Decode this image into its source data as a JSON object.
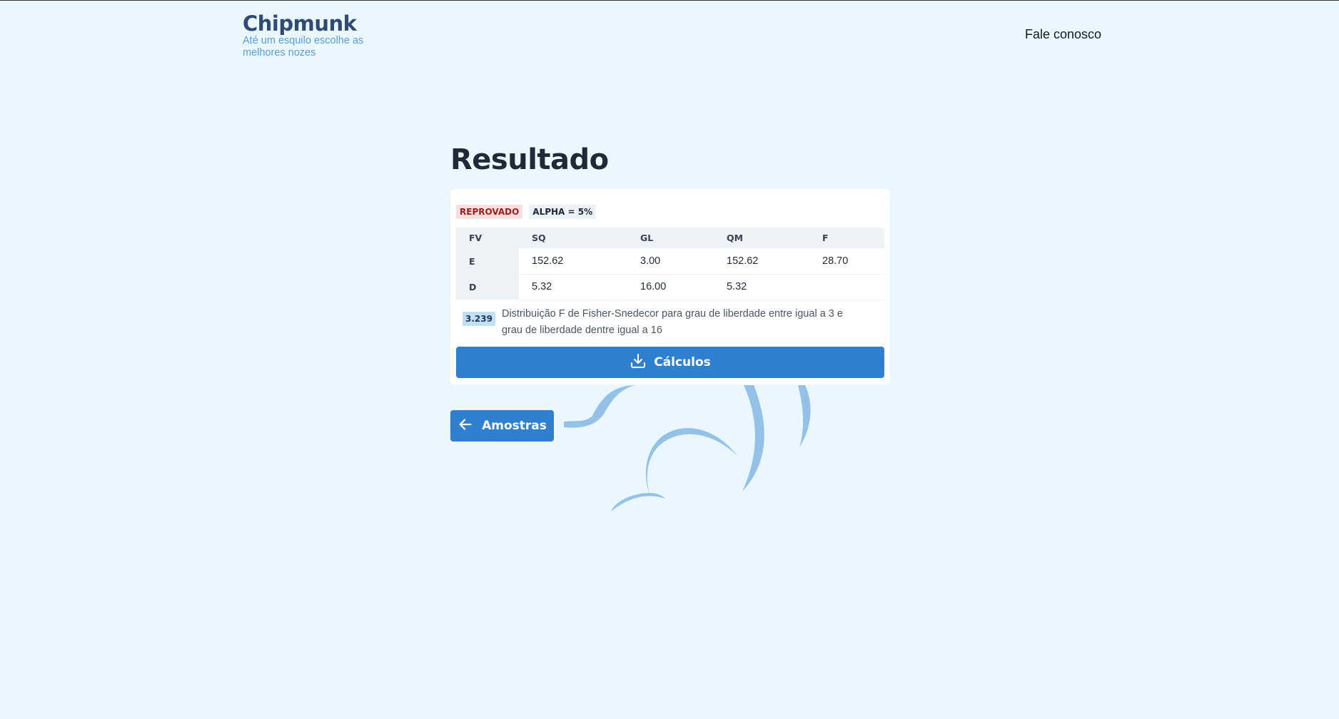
{
  "header": {
    "logo_title": "Chipmunk",
    "logo_tagline": "Até um esquilo escolhe as melhores nozes",
    "contact_link": "Fale conosco"
  },
  "main": {
    "title": "Resultado",
    "badges": {
      "status": "REPROVADO",
      "alpha": "ALPHA = 5%"
    },
    "table": {
      "headers": [
        "FV",
        "SQ",
        "GL",
        "QM",
        "F"
      ],
      "rows": [
        [
          "E",
          "152.62",
          "3.00",
          "152.62",
          "28.70"
        ],
        [
          "D",
          "5.32",
          "16.00",
          "5.32",
          ""
        ]
      ]
    },
    "critical_value": "3.239",
    "distribution_note": "Distribuição F de Fisher-Snedecor para grau de liberdade entre igual a 3 e grau de liberdade dentre igual a 16",
    "calc_button": "Cálculos",
    "back_button": "Amostras"
  },
  "icons": {
    "calc_button_icon": "download-icon",
    "back_button_icon": "arrow-left-icon"
  },
  "colors": {
    "background": "#ebf7fe",
    "accent": "#2f80d1",
    "fail_badge_bg": "#fcdede",
    "fail_badge_text": "#9b1c1c"
  }
}
